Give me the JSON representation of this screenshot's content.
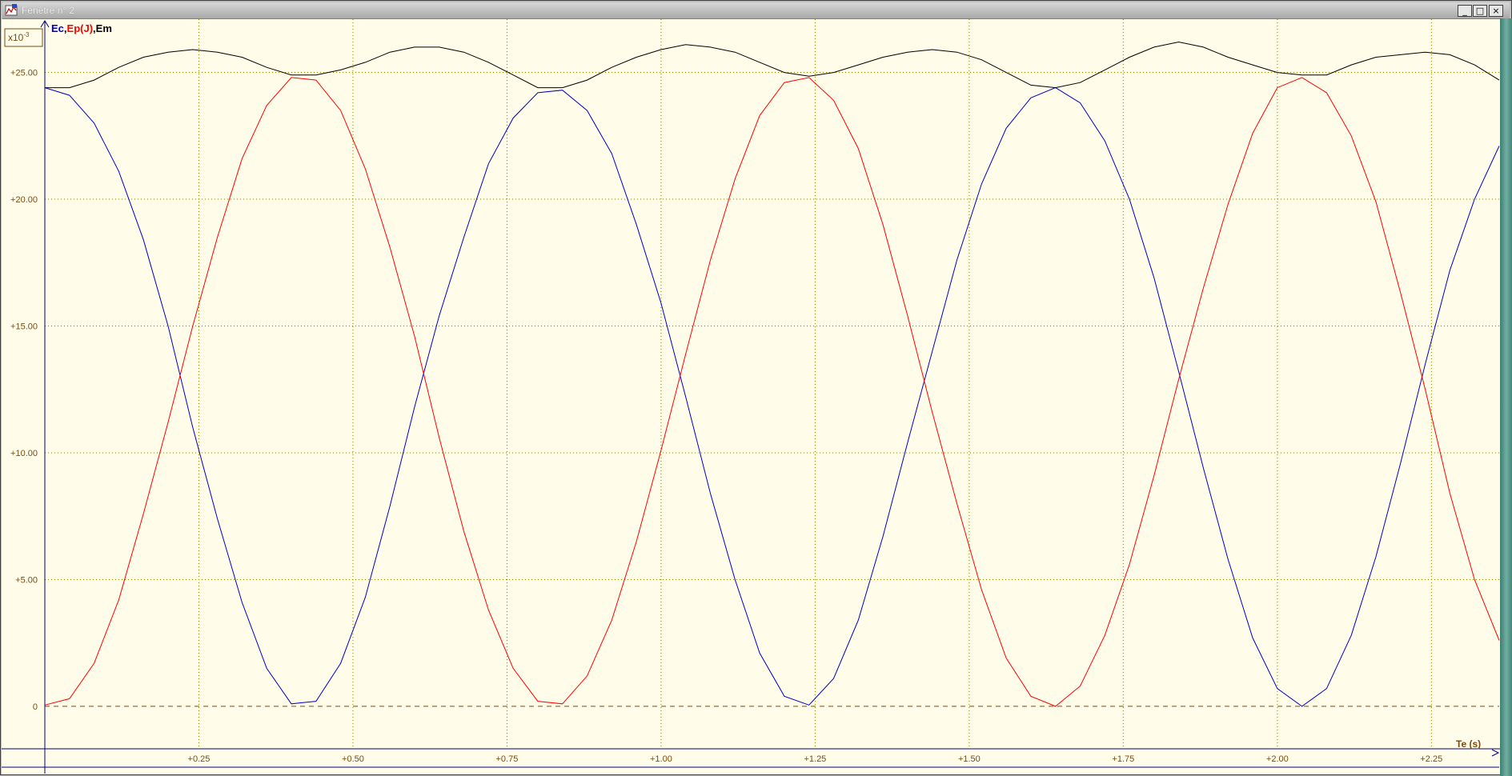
{
  "window": {
    "title": "Fenêtre n° 2",
    "minimize_icon": "minimize-icon",
    "maximize_icon": "maximize-icon",
    "close_icon": "close-icon"
  },
  "colors": {
    "background": "#fffcea",
    "grid": "#808000",
    "axis": "#000080",
    "tick_text": "#7a4c10",
    "ec": "#0000c8",
    "ep": "#ff0000",
    "em": "#000000",
    "zero_line": "#7a4c10"
  },
  "chart_data": {
    "type": "line",
    "scale_label": "x10-3",
    "legend": [
      {
        "text": "Ec",
        "color": "#0000c8"
      },
      {
        "text": ",",
        "color": "#000000"
      },
      {
        "text": "Ep(J)",
        "color": "#ff0000"
      },
      {
        "text": ",Em",
        "color": "#000000"
      }
    ],
    "xlabel": "Te (s)",
    "ylabel": "",
    "xlim": [
      0,
      2.36
    ],
    "ylim": [
      -2.4,
      27.1
    ],
    "grid": true,
    "x_ticks": [
      "+0.25",
      "+0.50",
      "+0.75",
      "+1.00",
      "+1.25",
      "+1.50",
      "+1.75",
      "+2.00",
      "+2.25"
    ],
    "x_tick_values": [
      0.25,
      0.5,
      0.75,
      1.0,
      1.25,
      1.5,
      1.75,
      2.0,
      2.25
    ],
    "y_ticks": [
      "0",
      "+5.00",
      "+10.00",
      "+15.00",
      "+20.00",
      "+25.00"
    ],
    "y_tick_values": [
      0,
      5,
      10,
      15,
      20,
      25
    ],
    "x": [
      0,
      0.04,
      0.08,
      0.12,
      0.16,
      0.2,
      0.24,
      0.28,
      0.32,
      0.36,
      0.4,
      0.44,
      0.48,
      0.52,
      0.56,
      0.6,
      0.64,
      0.68,
      0.72,
      0.76,
      0.8,
      0.84,
      0.88,
      0.92,
      0.96,
      1.0,
      1.04,
      1.08,
      1.12,
      1.16,
      1.2,
      1.24,
      1.28,
      1.32,
      1.36,
      1.4,
      1.44,
      1.48,
      1.52,
      1.56,
      1.6,
      1.64,
      1.68,
      1.72,
      1.76,
      1.8,
      1.84,
      1.88,
      1.92,
      1.96,
      2.0,
      2.04,
      2.08,
      2.12,
      2.16,
      2.2,
      2.24,
      2.28,
      2.32,
      2.36
    ],
    "series": [
      {
        "name": "Ec",
        "color": "#0000c8",
        "values": [
          24.4,
          24.1,
          23.0,
          21.1,
          18.4,
          15.0,
          11.0,
          7.4,
          4.1,
          1.5,
          0.1,
          0.2,
          1.7,
          4.3,
          7.9,
          11.8,
          15.4,
          18.5,
          21.4,
          23.2,
          24.2,
          24.3,
          23.5,
          21.8,
          19.0,
          15.9,
          12.2,
          8.4,
          5.0,
          2.1,
          0.4,
          0.05,
          1.1,
          3.4,
          6.7,
          10.4,
          14.0,
          17.6,
          20.6,
          22.8,
          24.0,
          24.4,
          23.8,
          22.3,
          20.0,
          16.9,
          13.2,
          9.4,
          5.8,
          2.7,
          0.7,
          0.0,
          0.7,
          2.8,
          5.9,
          9.6,
          13.5,
          17.2,
          20.0,
          22.1
        ]
      },
      {
        "name": "Ep(J)",
        "color": "#ff0000",
        "values": [
          0.05,
          0.3,
          1.7,
          4.2,
          7.6,
          11.2,
          15.0,
          18.5,
          21.6,
          23.7,
          24.8,
          24.7,
          23.5,
          21.2,
          18.1,
          14.6,
          10.6,
          6.9,
          3.8,
          1.5,
          0.2,
          0.1,
          1.2,
          3.4,
          6.5,
          10.1,
          13.9,
          17.6,
          20.8,
          23.3,
          24.6,
          24.8,
          23.9,
          22.0,
          19.0,
          15.4,
          11.6,
          8.0,
          4.6,
          1.9,
          0.4,
          0.0,
          0.8,
          2.8,
          5.6,
          9.1,
          12.9,
          16.5,
          19.8,
          22.6,
          24.4,
          24.8,
          24.2,
          22.5,
          19.9,
          16.3,
          12.5,
          8.4,
          5.0,
          2.6
        ]
      },
      {
        "name": "Em",
        "color": "#000000",
        "values": [
          24.4,
          24.4,
          24.7,
          25.2,
          25.6,
          25.8,
          25.9,
          25.8,
          25.6,
          25.2,
          24.9,
          24.9,
          25.1,
          25.4,
          25.8,
          26.0,
          26.0,
          25.8,
          25.4,
          24.9,
          24.4,
          24.4,
          24.7,
          25.2,
          25.6,
          25.9,
          26.1,
          26.0,
          25.8,
          25.4,
          25.0,
          24.85,
          25.0,
          25.3,
          25.6,
          25.8,
          25.9,
          25.8,
          25.5,
          25.0,
          24.5,
          24.4,
          24.6,
          25.1,
          25.6,
          26.0,
          26.2,
          26.0,
          25.6,
          25.3,
          25.0,
          24.9,
          24.9,
          25.3,
          25.6,
          25.7,
          25.8,
          25.7,
          25.3,
          24.7
        ]
      }
    ],
    "reference_line": {
      "y": 0,
      "style": "dashed"
    }
  }
}
